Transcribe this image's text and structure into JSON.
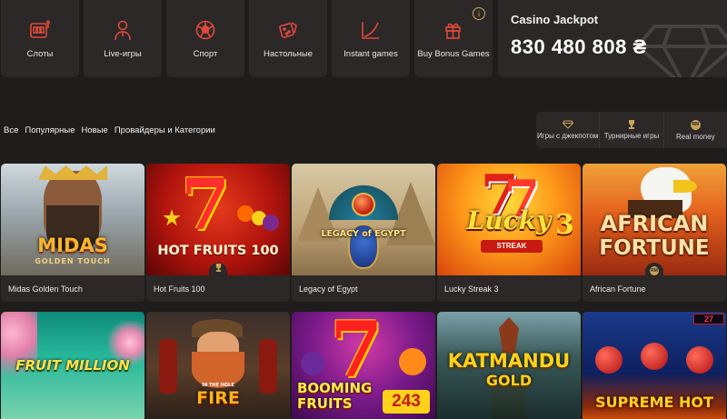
{
  "categories": [
    {
      "label": "Слоты",
      "icon": "slot-machine-icon"
    },
    {
      "label": "Live-игры",
      "icon": "dealer-icon"
    },
    {
      "label": "Спорт",
      "icon": "football-icon"
    },
    {
      "label": "Настольные",
      "icon": "dice-icon"
    },
    {
      "label": "Instant games",
      "icon": "chart-up-icon"
    },
    {
      "label": "Buy Bonus Games",
      "icon": "gift-icon"
    }
  ],
  "jackpot": {
    "title": "Casino Jackpot",
    "value": "830 480 808 ₴"
  },
  "filters": [
    "Все",
    "Популярные",
    "Новые",
    "Провайдеры и Категории"
  ],
  "feature_filters": [
    {
      "label": "Игры с джекпотом",
      "icon": "diamond-icon"
    },
    {
      "label": "Турнирные игры",
      "icon": "trophy-icon"
    },
    {
      "label": "Real money",
      "icon": "rm-icon",
      "icon_text": "RM"
    }
  ],
  "games": [
    {
      "name": "Midas Golden Touch",
      "art_text": "MIDAS",
      "art_sub": "GOLDEN TOUCH"
    },
    {
      "name": "Hot Fruits 100",
      "art_text": "HOT FRUITS 100",
      "badge": "trophy"
    },
    {
      "name": "Legacy of Egypt",
      "art_text": "LEGACY of EGYPT"
    },
    {
      "name": "Lucky Streak 3",
      "art_text": "Lucky",
      "art_sub": "STREAK",
      "art_num": "3"
    },
    {
      "name": "African Fortune",
      "art_text": "AFRICAN",
      "art_sub": "FORTUNE",
      "badge": "RM"
    },
    {
      "art_text": "FRUIT MILLION"
    },
    {
      "art_text": "FIRE",
      "art_sub": "IN THE HOLE"
    },
    {
      "art_text": "BOOMING FRUITS",
      "art_num": "243"
    },
    {
      "art_text": "KATMANDU",
      "art_sub": "GOLD"
    },
    {
      "art_text": "SUPREME HOT",
      "art_num": "27"
    }
  ],
  "colors": {
    "accent": "#e0483b",
    "gold": "#c9a45a",
    "bg": "#1f1d1c",
    "panel": "#2b2827"
  }
}
